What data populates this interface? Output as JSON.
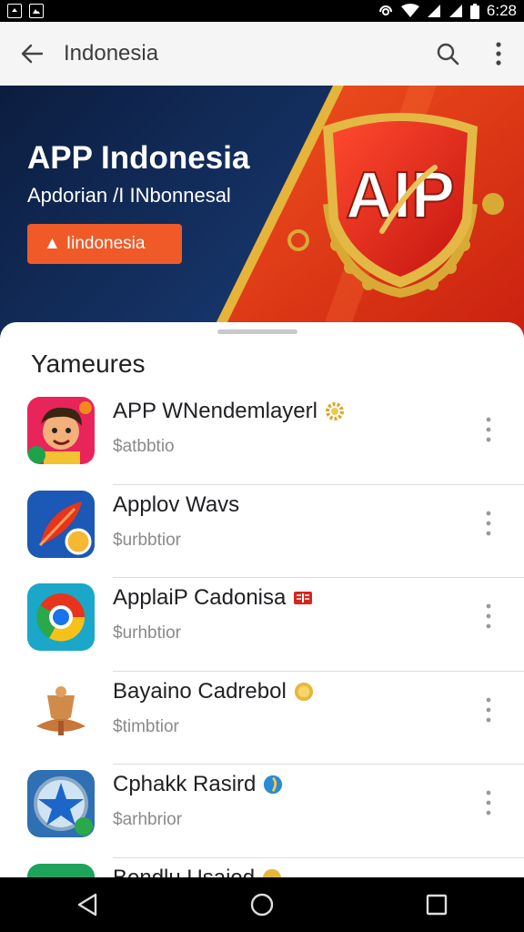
{
  "status_bar": {
    "time": "6:28",
    "left_icons": [
      "notification-icon",
      "gallery-icon"
    ],
    "right_icons": [
      "hotspot-icon",
      "wifi-icon",
      "signal-icon",
      "signal-icon",
      "battery-icon"
    ]
  },
  "app_bar": {
    "title": "Indonesia",
    "back_icon": "arrow-left-icon",
    "actions": [
      "search-icon",
      "more-vert-icon"
    ]
  },
  "banner": {
    "title": "APP Indonesia",
    "subtitle": "Apdorian /I INbonnesal",
    "button_label": "Iindonesia",
    "emblem_text": "AIP",
    "colors": {
      "navy": "#0c1d3f",
      "red": "#e8341c",
      "gold": "#d9a935",
      "orange": "#f05a28"
    }
  },
  "section": {
    "title": "Yameures"
  },
  "apps": [
    {
      "name": "APP WNendemlayerl",
      "subtitle": "$atbbtio",
      "icon": "avatar-boy-icon",
      "badge": "gear-badge-icon"
    },
    {
      "name": "Applov Wavs",
      "subtitle": "$urbbtior",
      "icon": "feather-icon",
      "badge": ""
    },
    {
      "name": "ApplaiP Cadonisa",
      "subtitle": "$urhbtior",
      "icon": "chrome-icon",
      "badge": "book-badge-icon"
    },
    {
      "name": "Bayaino Cadrebol",
      "subtitle": "$timbtior",
      "icon": "trophy-icon",
      "badge": "coin-badge-icon"
    },
    {
      "name": "Cphakk Rasird",
      "subtitle": "$arhbrior",
      "icon": "star-compass-icon",
      "badge": "globe-badge-icon"
    },
    {
      "name": "Bendlu Usaied",
      "subtitle": "",
      "icon": "green-app-icon",
      "badge": "coin-badge-icon"
    }
  ],
  "nav_bar": {
    "buttons": [
      "back-triangle-icon",
      "home-circle-icon",
      "recents-square-icon"
    ]
  }
}
